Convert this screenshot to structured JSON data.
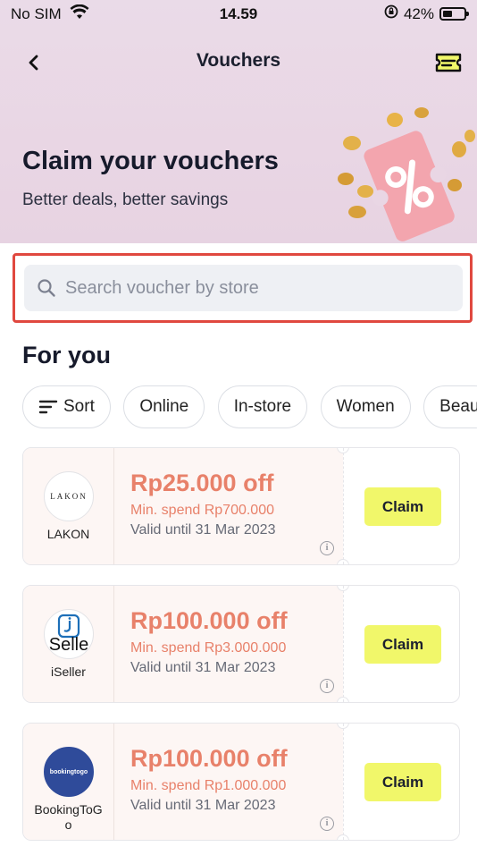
{
  "status_bar": {
    "carrier": "No SIM",
    "time": "14.59",
    "battery": "42%"
  },
  "nav": {
    "title": "Vouchers"
  },
  "hero": {
    "title": "Claim your vouchers",
    "subtitle": "Better deals, better savings"
  },
  "search": {
    "placeholder": "Search voucher by store"
  },
  "section_title": "For you",
  "filters": [
    "Sort",
    "Online",
    "In-store",
    "Women",
    "Beau"
  ],
  "vouchers": [
    {
      "store": "LAKON",
      "logo_text": "LAKON",
      "amount": "Rp25.000 off",
      "min_spend": "Min. spend Rp700.000",
      "valid": "Valid until 31 Mar 2023",
      "claim": "Claim"
    },
    {
      "store": "iSeller",
      "logo_text": "Selle",
      "amount": "Rp100.000 off",
      "min_spend": "Min. spend Rp3.000.000",
      "valid": "Valid until 31 Mar 2023",
      "claim": "Claim"
    },
    {
      "store": "BookingToGo",
      "logo_text": "bookingtogo",
      "amount": "Rp100.000 off",
      "min_spend": "Min. spend Rp1.000.000",
      "valid": "Valid until 31 Mar 2023",
      "claim": "Claim"
    }
  ],
  "colors": {
    "accent_orange": "#e8816a",
    "claim_yellow": "#f1f76a",
    "highlight_red": "#e0483f",
    "hero_bg": "#eadbe8",
    "booking_blue": "#2f4b9a",
    "iseller_blue": "#1d6fb8"
  }
}
